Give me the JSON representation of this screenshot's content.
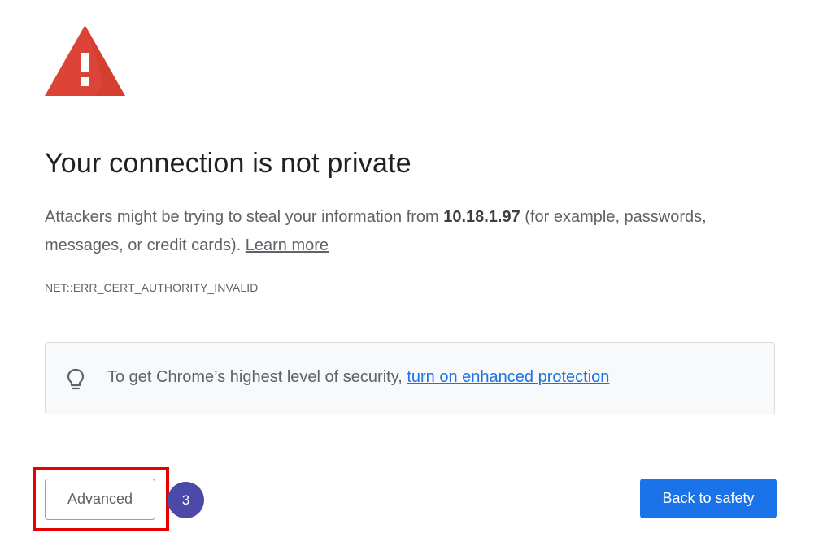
{
  "colors": {
    "warning_red": "#db4437",
    "link_blue": "#1a73e8",
    "primary_button": "#1a73e8",
    "highlight_red": "#e60000",
    "badge_purple": "#4b4aa8"
  },
  "icons": {
    "warning": "warning-triangle-icon",
    "bulb": "lightbulb-icon"
  },
  "title": "Your connection is not private",
  "message": {
    "part1": "Attackers might be trying to steal your information from ",
    "host": "10.18.1.97",
    "part2": " (for example, passwords, messages, or credit cards). ",
    "learn_more": "Learn more"
  },
  "error_code": "NET::ERR_CERT_AUTHORITY_INVALID",
  "enhanced": {
    "text": "To get Chrome’s highest level of security, ",
    "link": "turn on enhanced protection"
  },
  "buttons": {
    "advanced": "Advanced",
    "back_to_safety": "Back to safety"
  },
  "annotation": {
    "step_number": "3"
  }
}
